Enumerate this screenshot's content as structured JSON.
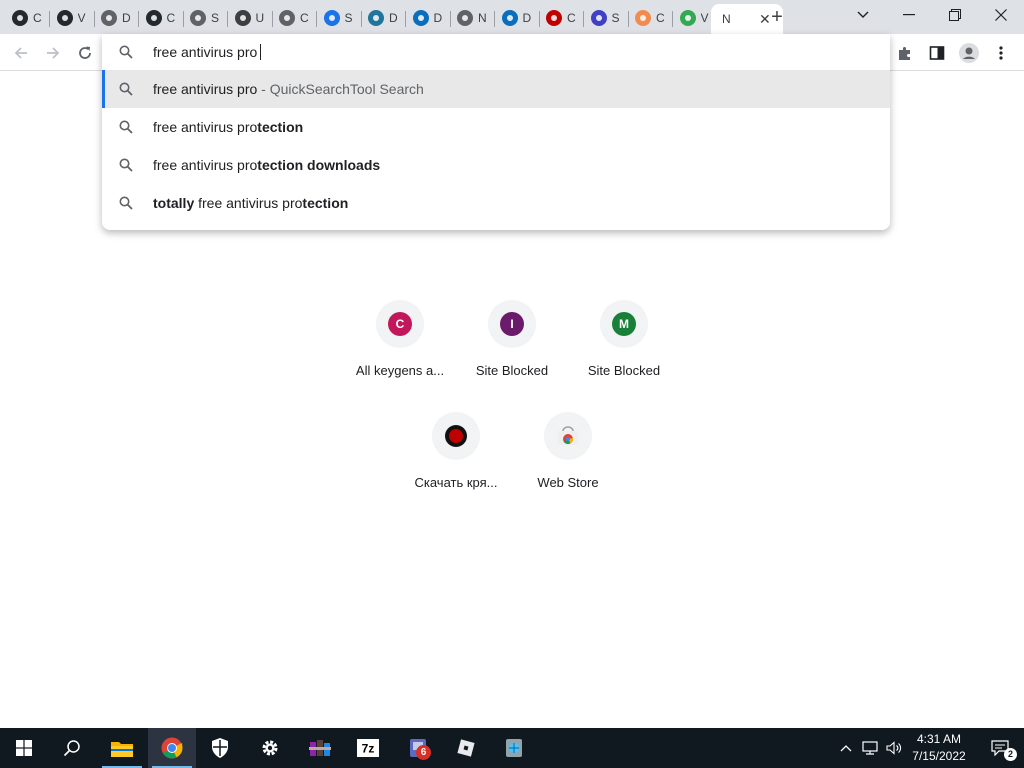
{
  "browser": {
    "tabs": [
      {
        "icon": "github-icon",
        "label": "C",
        "color": "#24292f"
      },
      {
        "icon": "github-icon",
        "label": "V",
        "color": "#24292f"
      },
      {
        "icon": "globe-icon",
        "label": "D",
        "color": "#5f6368"
      },
      {
        "icon": "github-icon",
        "label": "C",
        "color": "#24292f"
      },
      {
        "icon": "globe-icon",
        "label": "S",
        "color": "#5f6368"
      },
      {
        "icon": "lock-icon",
        "label": "U",
        "color": "#3c4043"
      },
      {
        "icon": "globe-icon",
        "label": "C",
        "color": "#5f6368"
      },
      {
        "icon": "gear-icon",
        "label": "S",
        "color": "#1a73e8"
      },
      {
        "icon": "wordpress-icon",
        "label": "D",
        "color": "#21759b"
      },
      {
        "icon": "edge-icon",
        "label": "D",
        "color": "#0a6ebd"
      },
      {
        "icon": "globe-icon",
        "label": "N",
        "color": "#5f6368"
      },
      {
        "icon": "edge-icon",
        "label": "D",
        "color": "#0a6ebd"
      },
      {
        "icon": "record-icon",
        "label": "C",
        "color": "#c00000"
      },
      {
        "icon": "cube-icon",
        "label": "S",
        "color": "#3f3fc7"
      },
      {
        "icon": "search-circle-icon",
        "label": "C",
        "color": "#f28b50"
      },
      {
        "icon": "circle-logo-icon",
        "label": "V",
        "color": "#34a853"
      }
    ],
    "active_tab": {
      "label": "N",
      "close_glyph": "✕"
    },
    "new_tab_glyph": "+"
  },
  "omnibox": {
    "input_value": "free antivirus pro",
    "suggestions": [
      {
        "parts": [
          {
            "t": "free antivirus pro",
            "b": false
          }
        ],
        "provider": " - QuickSearchTool Search",
        "selected": true
      },
      {
        "parts": [
          {
            "t": "free antivirus pro",
            "b": false
          },
          {
            "t": "tection",
            "b": true
          }
        ],
        "provider": "",
        "selected": false
      },
      {
        "parts": [
          {
            "t": "free antivirus pro",
            "b": false
          },
          {
            "t": "tection downloads",
            "b": true
          }
        ],
        "provider": "",
        "selected": false
      },
      {
        "parts": [
          {
            "t": "totally",
            "b": true
          },
          {
            "t": " free antivirus pro",
            "b": false
          },
          {
            "t": "tection",
            "b": true
          }
        ],
        "provider": "",
        "selected": false
      }
    ]
  },
  "shortcuts": [
    {
      "initial": "C",
      "label": "All keygens a...",
      "color": "#c2185b",
      "icon": "letter-c-icon"
    },
    {
      "initial": "I",
      "label": "Site Blocked",
      "color": "#6a1b6a",
      "icon": "letter-i-icon"
    },
    {
      "initial": "M",
      "label": "Site Blocked",
      "color": "#188038",
      "icon": "letter-m-icon"
    },
    {
      "initial": "",
      "label": "Скачать кря...",
      "color": "#c00000",
      "icon": "red-record-icon"
    },
    {
      "initial": "",
      "label": "Web Store",
      "color": "#4285f4",
      "icon": "web-store-icon"
    }
  ],
  "taskbar": {
    "time": "4:31 AM",
    "date": "7/15/2022",
    "notification_count": "2",
    "app_badge": "6",
    "colors": {
      "bg": "#101820",
      "accent": "#76b9ed"
    }
  }
}
